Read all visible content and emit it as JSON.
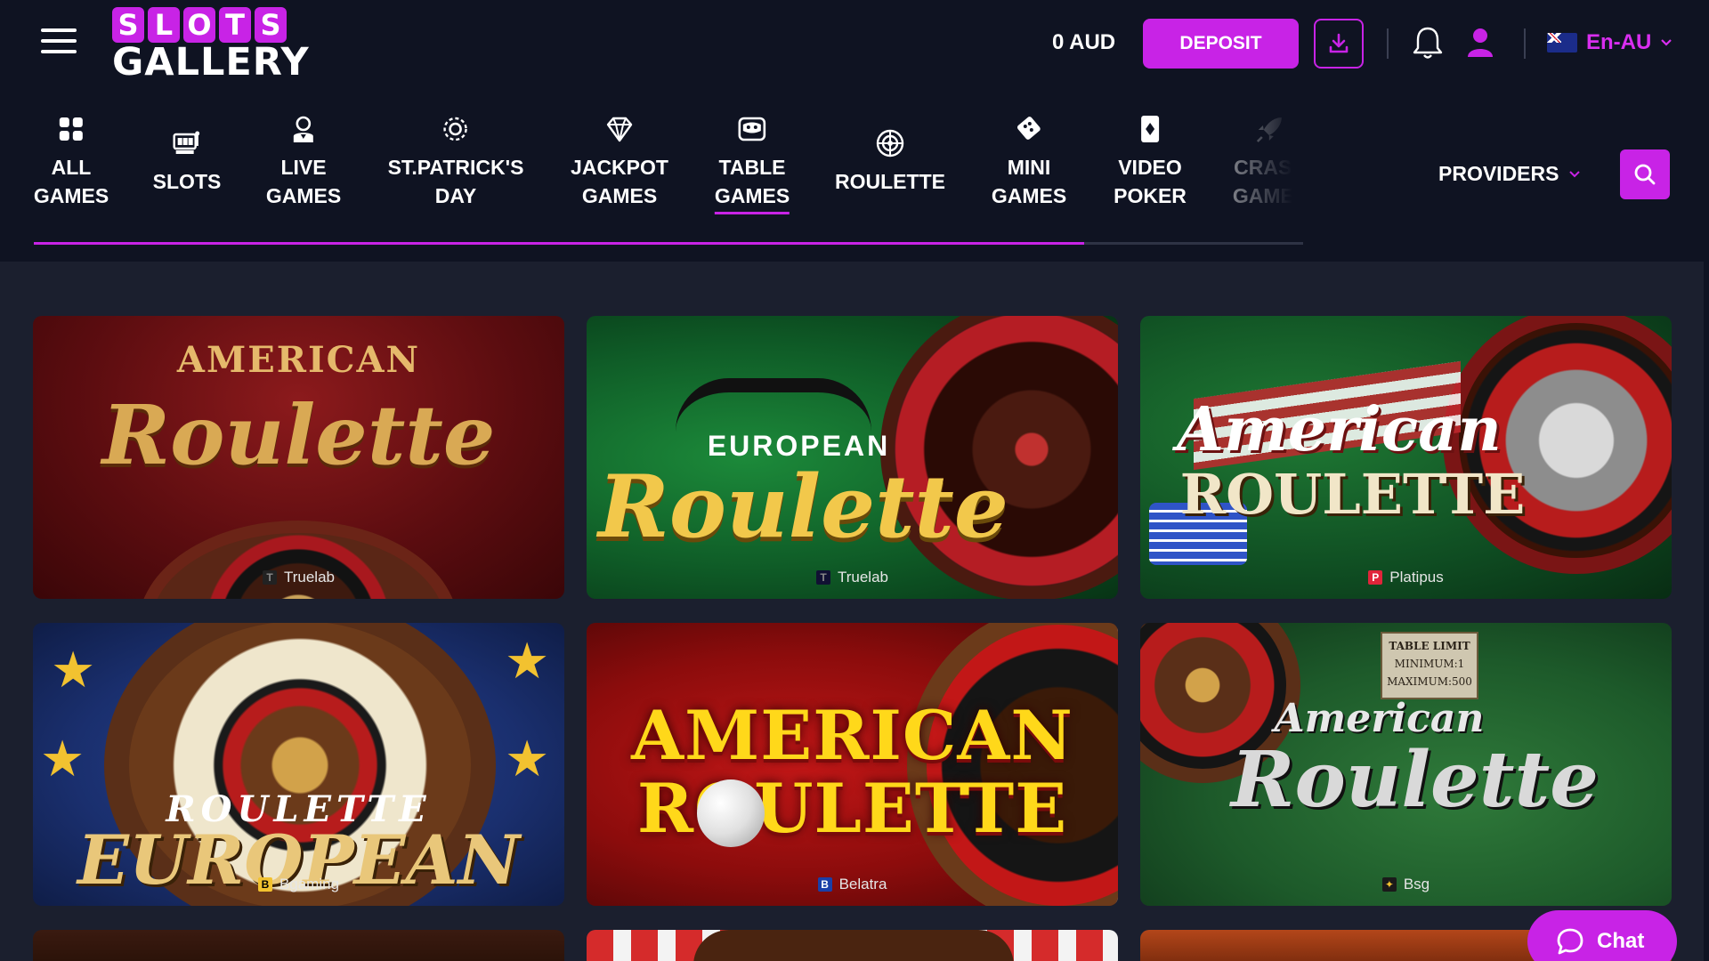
{
  "header": {
    "logo_top_letters": [
      "S",
      "L",
      "O",
      "T",
      "S"
    ],
    "logo_bottom": "GALLERY",
    "balance": "0 AUD",
    "deposit_label": "DEPOSIT",
    "language": "En-AU"
  },
  "categories": [
    {
      "label_lines": [
        "ALL",
        "GAMES"
      ],
      "icon": "grid-icon"
    },
    {
      "label_lines": [
        "SLOTS"
      ],
      "icon": "slot-machine-icon"
    },
    {
      "label_lines": [
        "LIVE",
        "GAMES"
      ],
      "icon": "dealer-icon"
    },
    {
      "label_lines": [
        "ST.PATRICK'S",
        "DAY"
      ],
      "icon": "clover-badge-icon"
    },
    {
      "label_lines": [
        "JACKPOT",
        "GAMES"
      ],
      "icon": "diamond-icon"
    },
    {
      "label_lines": [
        "TABLE",
        "GAMES"
      ],
      "icon": "table-icon",
      "active": true
    },
    {
      "label_lines": [
        "ROULETTE"
      ],
      "icon": "roulette-icon"
    },
    {
      "label_lines": [
        "MINI",
        "GAMES"
      ],
      "icon": "dice-icon"
    },
    {
      "label_lines": [
        "VIDEO",
        "POKER"
      ],
      "icon": "card-icon"
    },
    {
      "label_lines": [
        "CRASH",
        "GAMES"
      ],
      "icon": "rocket-icon"
    }
  ],
  "providers_label": "PROVIDERS",
  "games": [
    {
      "title_lines": [
        "AMERICAN",
        "Roulette"
      ],
      "provider": "Truelab",
      "theme": "red-gold"
    },
    {
      "title_lines": [
        "EUROPEAN",
        "Roulette"
      ],
      "provider": "Truelab",
      "theme": "green-gold"
    },
    {
      "title_lines": [
        "American",
        "ROULETTE"
      ],
      "provider": "Platipus",
      "theme": "green-flag"
    },
    {
      "title_lines": [
        "ROULETTE",
        "EUROPEAN"
      ],
      "provider": "Bgaming",
      "theme": "blue-wood"
    },
    {
      "title_lines": [
        "AMERICAN",
        "ROULETTE"
      ],
      "provider": "Belatra",
      "theme": "red-yellow"
    },
    {
      "title_lines": [
        "TABLE LIMIT",
        "MINIMUM:1",
        "MAXIMUM:500",
        "American",
        "Roulette"
      ],
      "provider": "Bsg",
      "theme": "green-felt"
    }
  ],
  "chat_label": "Chat",
  "colors": {
    "accent": "#c823e6",
    "background": "#1b1f2e",
    "header": "#0f1322"
  }
}
